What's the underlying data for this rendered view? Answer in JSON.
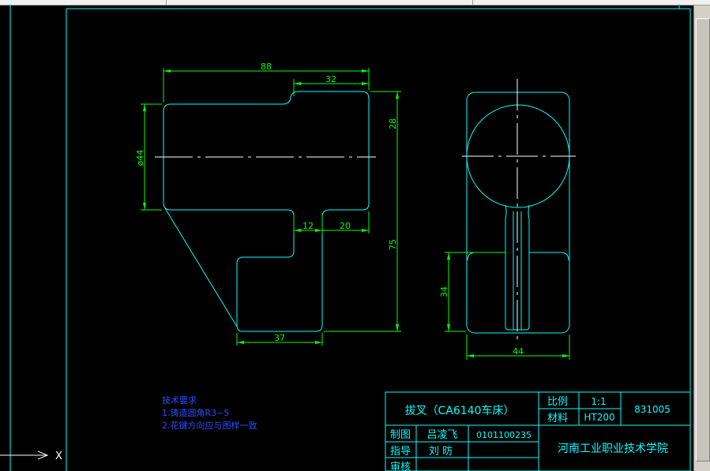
{
  "colors": {
    "background": "#000000",
    "outline": "#00ffff",
    "dimension": "#00ff00",
    "centerline": "#ffffff",
    "notes": "#2b4cff",
    "title_text": "#00ffff",
    "frame": "#00ffff"
  },
  "drawing": {
    "dimensions": {
      "overall_width": "88",
      "top_slot_width": "32",
      "diameter": "ø44",
      "upper_height": "28",
      "total_height": "75",
      "neck_width": "12",
      "right_step": "20",
      "bottom_width": "37",
      "side_height": "34",
      "side_width": "44"
    }
  },
  "notes": {
    "title": "技术要求",
    "line1": "1.铸造圆角R3~5",
    "line2": "2.花键方向应与图样一致"
  },
  "title_block": {
    "part_name": "拔叉（CA6140车床）",
    "scale_label": "比例",
    "scale_value": "1:1",
    "material_label": "材料",
    "material_value": "HT200",
    "drawing_number": "831005",
    "drawn_label": "制图",
    "drawn_name": "吕凌飞",
    "student_id": "0101100235",
    "guide_label": "指导",
    "guide_name": "刘 昉",
    "review_label": "审核",
    "school": "河南工业职业技术学院"
  },
  "ucs": {
    "x_label": "X"
  }
}
